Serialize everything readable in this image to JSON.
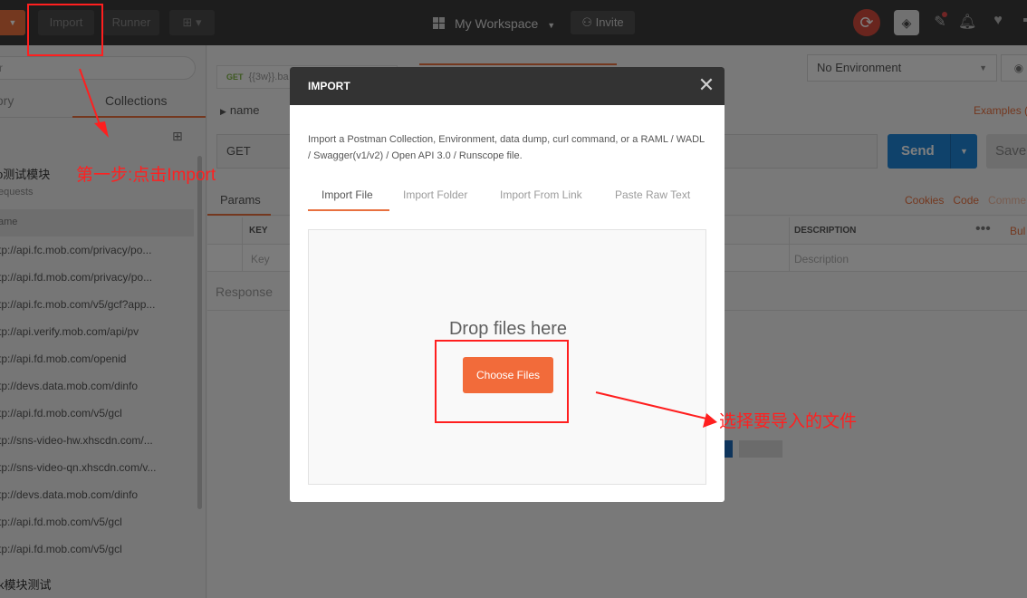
{
  "topbar": {
    "import_label": "Import",
    "runner_label": "Runner",
    "workspace_label": "My Workspace",
    "invite_label": "Invite"
  },
  "sidebar": {
    "filter_placeholder": "r",
    "tab_history": "tory",
    "tab_collections": "Collections",
    "collection_name": "o测试模块",
    "collection_sub": "equests",
    "selected_item": "ame",
    "requests": [
      "tp://api.fc.mob.com/privacy/po...",
      "tp://api.fd.mob.com/privacy/po...",
      "tp://api.fc.mob.com/v5/gcf?app...",
      "tp://api.verify.mob.com/api/pv",
      "tp://api.fd.mob.com/openid",
      "tp://devs.data.mob.com/dinfo",
      "tp://api.fd.mob.com/v5/gcl",
      "tp://sns-video-hw.xhscdn.com/...",
      "tp://sns-video-qn.xhscdn.com/v...",
      "tp://devs.data.mob.com/dinfo",
      "tp://api.fd.mob.com/v5/gcl",
      "tp://api.fd.mob.com/v5/gcl"
    ],
    "collection2_name": "k模块测试"
  },
  "main": {
    "tab_method": "GET",
    "tab_url": "{{3w}}.ba",
    "environment": "No Environment",
    "request_name": "name",
    "examples_link": "Examples (",
    "method": "GET",
    "send_label": "Send",
    "save_label": "Save",
    "params_tab": "Params",
    "link_cookies": "Cookies",
    "link_code": "Code",
    "link_comments": "Comme",
    "col_key": "KEY",
    "col_description": "DESCRIPTION",
    "bulk_label": "Bul",
    "key_placeholder": "Key",
    "desc_placeholder": "Description",
    "response_label": "Response"
  },
  "modal": {
    "title": "IMPORT",
    "description": "Import a Postman Collection, Environment, data dump, curl command, or a RAML / WADL / Swagger(v1/v2) / Open API 3.0 / Runscope file.",
    "tabs": [
      "Import File",
      "Import Folder",
      "Import From Link",
      "Paste Raw Text"
    ],
    "drop_text": "Drop files here",
    "choose_label": "Choose Files"
  },
  "annotations": {
    "step1": "第一步:点击Import",
    "step2": "选择要导入的文件"
  },
  "colors": {
    "accent": "#e8703f",
    "send_blue": "#1f84d6",
    "annotation_red": "#ff1f1f",
    "sync_red": "#d24a3d"
  }
}
